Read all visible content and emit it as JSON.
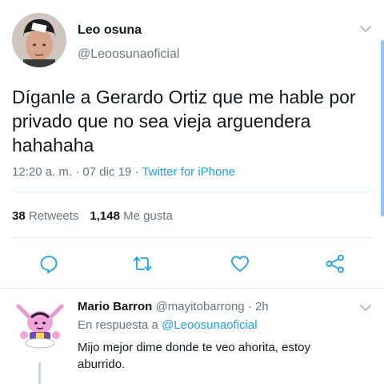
{
  "tweet": {
    "author_name": "Leo osuna",
    "author_handle": "@Leoosunaoficial",
    "text": "Díganle a Gerardo Ortiz que me hable por privado que no sea vieja arguendera hahahaha",
    "time": "12:20 a. m. · 07 dic 19 · ",
    "source": "Twitter for iPhone",
    "retweets_count": "38",
    "retweets_label": "Retweets",
    "likes_count": "1,148",
    "likes_label": "Me gusta",
    "actions": [
      "reply-icon",
      "retweet-icon",
      "like-icon",
      "share-icon"
    ]
  },
  "reply": {
    "author_name": "Mario Barron",
    "author_handle": "@mayitobarrong · 2h",
    "reply_prefix": "En respuesta a ",
    "reply_mention": "@Leoosunaoficial",
    "text": "Mijo mejor dime donde te veo ahorita, estoy aburrido."
  },
  "colors": {
    "accent": "#1da1f2",
    "secondary_text": "#657786",
    "divider": "#e1e8ed",
    "icon": "#657786"
  }
}
